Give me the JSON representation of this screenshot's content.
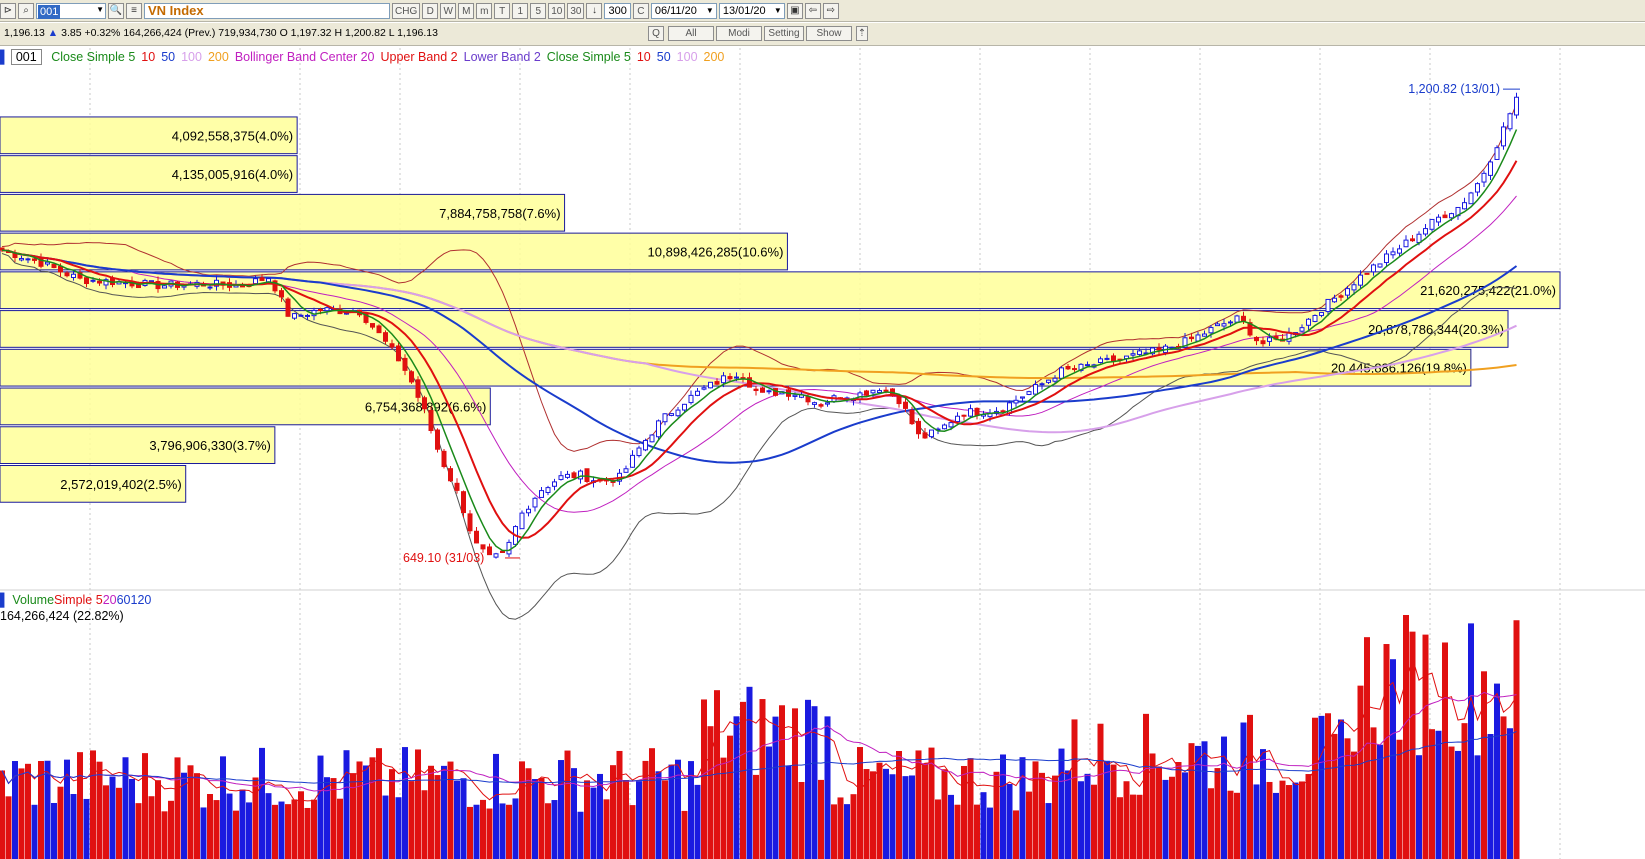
{
  "toolbar": {
    "code": "001",
    "name": "VN Index",
    "chg_label": "CHG",
    "periods": [
      "D",
      "W",
      "M",
      "m",
      "T"
    ],
    "intervals": [
      "1",
      "5",
      "10",
      "30"
    ],
    "bars": "300",
    "c_label": "C",
    "date_from": "06/11/20",
    "date_to": "13/01/20"
  },
  "infobar": {
    "text_prefix": "1,196.13",
    "change": "3.85",
    "pct": "+0.32%",
    "text_rest": "164,266,424 (Prev.) 719,934,730 O 1,197.32 H 1,200.82 L 1,196.13",
    "buttons": {
      "q": "Q",
      "all": "All",
      "modi": "Modi",
      "setting": "Setting",
      "show": "Show"
    }
  },
  "legend": {
    "badge": "001",
    "items": [
      {
        "text": "Close Simple 5",
        "color": "#1a8a1a"
      },
      {
        "text": "10",
        "color": "#e01010"
      },
      {
        "text": "50",
        "color": "#1a3ccc"
      },
      {
        "text": "100",
        "color": "#d7a0ea"
      },
      {
        "text": "200",
        "color": "#f0a020"
      },
      {
        "text": "Bollinger Band Center 20",
        "color": "#c020c0"
      },
      {
        "text": "Upper Band 2",
        "color": "#e01010"
      },
      {
        "text": "Lower Band 2",
        "color": "#6a3ccc"
      },
      {
        "text": "Close Simple 5",
        "color": "#1a8a1a"
      },
      {
        "text": "10",
        "color": "#e01010"
      },
      {
        "text": "50",
        "color": "#1a3ccc"
      },
      {
        "text": "100",
        "color": "#d7a0ea"
      },
      {
        "text": "200",
        "color": "#f0a020"
      }
    ]
  },
  "volume_legend": {
    "items": [
      {
        "text": "Volume",
        "color": "#1a8a1a"
      },
      {
        "text": "Simple 5",
        "color": "#e01010"
      },
      {
        "text": "20",
        "color": "#c020c0"
      },
      {
        "text": "60",
        "color": "#1a3ccc"
      },
      {
        "text": "120",
        "color": "#1a3ccc"
      }
    ],
    "value": "164,266,424 (22.82%)"
  },
  "annotations": {
    "high": "1,200.82 (13/01)",
    "low": "649.10 (31/03)"
  },
  "colors": {
    "up": "#e01010",
    "down": "#1a1ae0",
    "profile_fill": "#ffff99",
    "ma5": "#1a8a1a",
    "ma10": "#e01010",
    "ma50": "#1a3ccc",
    "ma100": "#d7a0ea",
    "ma200": "#f0a020",
    "bb_center": "#c020c0",
    "bb_upper": "#b03030",
    "bb_lower": "#555555"
  },
  "chart_data": {
    "type": "candlestick",
    "title": "VN Index",
    "ylim": [
      620,
      1230
    ],
    "volume_profile": [
      {
        "label": "4,092,558,375(4.0%)",
        "pct": 4.0,
        "price_low": 1120,
        "price_high": 1165
      },
      {
        "label": "4,135,005,916(4.0%)",
        "pct": 4.0,
        "price_low": 1075,
        "price_high": 1120
      },
      {
        "label": "7,884,758,758(7.6%)",
        "pct": 7.6,
        "price_low": 1030,
        "price_high": 1075
      },
      {
        "label": "10,898,426,285(10.6%)",
        "pct": 10.6,
        "price_low": 985,
        "price_high": 1030
      },
      {
        "label": "21,620,275,422(21.0%)",
        "pct": 21.0,
        "price_low": 940,
        "price_high": 985
      },
      {
        "label": "20,878,786,344(20.3%)",
        "pct": 20.3,
        "price_low": 895,
        "price_high": 940
      },
      {
        "label": "20,445,886,126(19.8%)",
        "pct": 19.8,
        "price_low": 850,
        "price_high": 895
      },
      {
        "label": "6,754,368,892(6.6%)",
        "pct": 6.6,
        "price_low": 805,
        "price_high": 850
      },
      {
        "label": "3,796,906,330(3.7%)",
        "pct": 3.7,
        "price_low": 760,
        "price_high": 805
      },
      {
        "label": "2,572,019,402(2.5%)",
        "pct": 2.5,
        "price_low": 715,
        "price_high": 760
      }
    ],
    "close_path": [
      [
        0,
        1010
      ],
      [
        40,
        995
      ],
      [
        80,
        975
      ],
      [
        120,
        972
      ],
      [
        160,
        968
      ],
      [
        200,
        970
      ],
      [
        240,
        968
      ],
      [
        270,
        978
      ],
      [
        290,
        930
      ],
      [
        320,
        940
      ],
      [
        360,
        938
      ],
      [
        380,
        910
      ],
      [
        400,
        880
      ],
      [
        410,
        860
      ],
      [
        425,
        820
      ],
      [
        440,
        770
      ],
      [
        460,
        720
      ],
      [
        475,
        668
      ],
      [
        490,
        650
      ],
      [
        505,
        655
      ],
      [
        520,
        700
      ],
      [
        540,
        730
      ],
      [
        560,
        745
      ],
      [
        580,
        748
      ],
      [
        600,
        740
      ],
      [
        620,
        745
      ],
      [
        640,
        780
      ],
      [
        660,
        810
      ],
      [
        680,
        830
      ],
      [
        700,
        845
      ],
      [
        720,
        858
      ],
      [
        740,
        868
      ],
      [
        760,
        840
      ],
      [
        780,
        845
      ],
      [
        800,
        842
      ],
      [
        820,
        830
      ],
      [
        840,
        840
      ],
      [
        860,
        842
      ],
      [
        880,
        850
      ],
      [
        900,
        835
      ],
      [
        920,
        790
      ],
      [
        940,
        800
      ],
      [
        960,
        820
      ],
      [
        980,
        822
      ],
      [
        1000,
        824
      ],
      [
        1020,
        838
      ],
      [
        1040,
        852
      ],
      [
        1060,
        868
      ],
      [
        1080,
        872
      ],
      [
        1100,
        878
      ],
      [
        1120,
        882
      ],
      [
        1140,
        888
      ],
      [
        1160,
        892
      ],
      [
        1180,
        900
      ],
      [
        1200,
        910
      ],
      [
        1220,
        922
      ],
      [
        1240,
        930
      ],
      [
        1260,
        900
      ],
      [
        1280,
        905
      ],
      [
        1300,
        920
      ],
      [
        1320,
        940
      ],
      [
        1340,
        958
      ],
      [
        1360,
        978
      ],
      [
        1380,
        995
      ],
      [
        1400,
        1012
      ],
      [
        1420,
        1030
      ],
      [
        1440,
        1048
      ],
      [
        1460,
        1060
      ],
      [
        1480,
        1090
      ],
      [
        1500,
        1140
      ],
      [
        1520,
        1196
      ]
    ],
    "high": 1200.82,
    "low": 649.1
  }
}
